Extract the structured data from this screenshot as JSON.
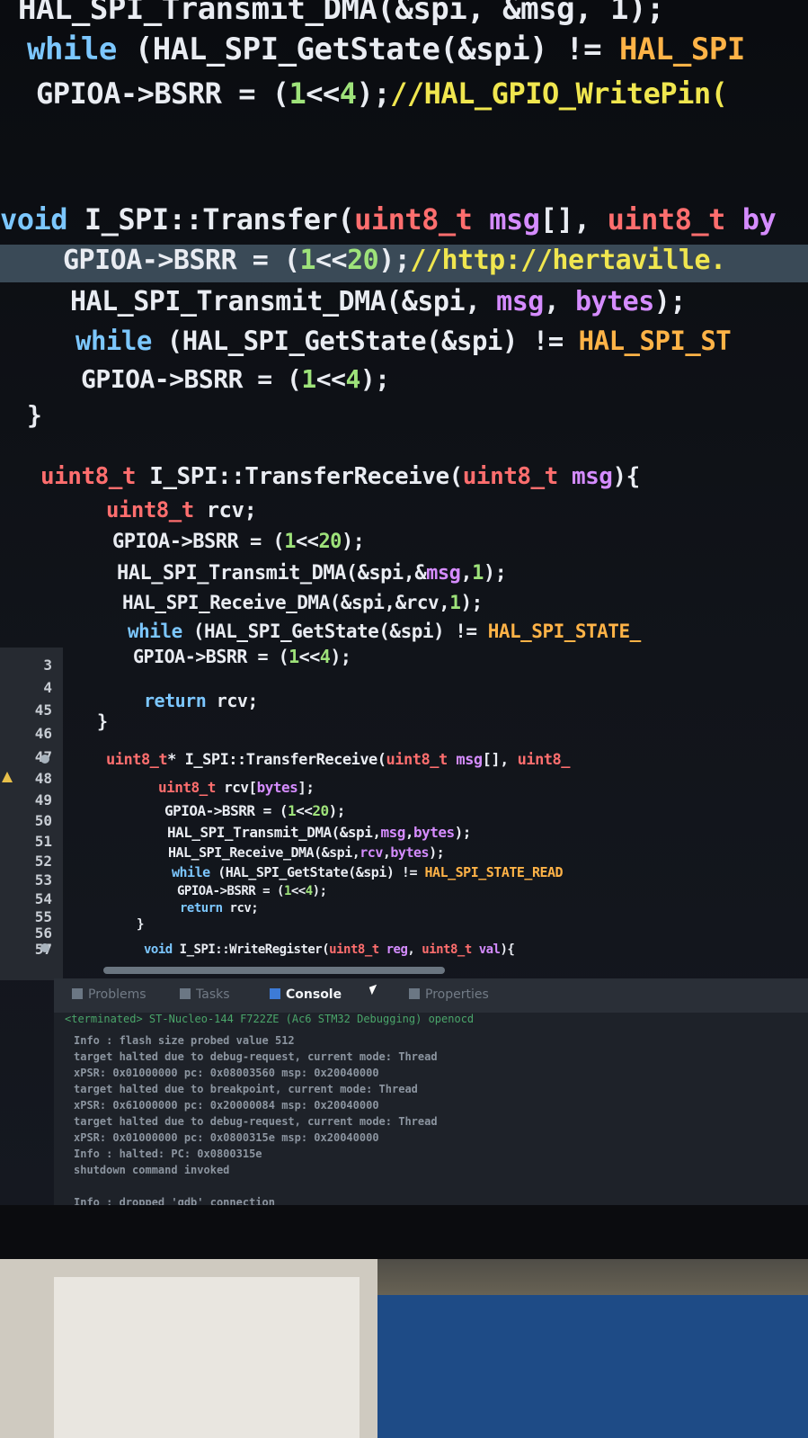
{
  "code_lines": [
    {
      "id": "l1",
      "parts": [
        [
          "tx",
          "HAL_SPI_Transmit_DMA(&spi, &msg, 1);"
        ]
      ]
    },
    {
      "id": "l2",
      "parts": [
        [
          "kw",
          "while "
        ],
        [
          "tx",
          "(HAL_SPI_GetState(&spi) != "
        ],
        [
          "str",
          "HAL_SPI"
        ]
      ]
    },
    {
      "id": "l3",
      "parts": [
        [
          "tx",
          "GPIOA->BSRR = "
        ],
        [
          "tx",
          "("
        ],
        [
          "num",
          "1"
        ],
        [
          "tx",
          "<<"
        ],
        [
          "num",
          "4"
        ],
        [
          "tx",
          ");"
        ],
        [
          "cmt",
          "//HAL_GPIO_WritePin("
        ]
      ]
    },
    {
      "id": "l4",
      "parts": [
        [
          "kw",
          "void "
        ],
        [
          "tx",
          "I_SPI::Transfer("
        ],
        [
          "ty",
          "uint8_t "
        ],
        [
          "par",
          "msg"
        ],
        [
          "tx",
          "[], "
        ],
        [
          "ty",
          "uint8_t "
        ],
        [
          "par",
          "by"
        ]
      ]
    },
    {
      "id": "l5",
      "parts": [
        [
          "tx",
          "GPIOA->BSRR = ("
        ],
        [
          "num",
          "1"
        ],
        [
          "tx",
          "<<"
        ],
        [
          "num",
          "20"
        ],
        [
          "tx",
          ");"
        ],
        [
          "cmt",
          "//http://hertaville."
        ]
      ]
    },
    {
      "id": "l6",
      "parts": [
        [
          "tx",
          "HAL_SPI_Transmit_DMA(&spi, "
        ],
        [
          "par",
          "msg"
        ],
        [
          "tx",
          ", "
        ],
        [
          "par",
          "bytes"
        ],
        [
          "tx",
          ");"
        ]
      ]
    },
    {
      "id": "l7",
      "parts": [
        [
          "kw",
          "while "
        ],
        [
          "tx",
          "(HAL_SPI_GetState(&spi) != "
        ],
        [
          "str",
          "HAL_SPI_ST"
        ]
      ]
    },
    {
      "id": "l8",
      "parts": [
        [
          "tx",
          "GPIOA->BSRR = ("
        ],
        [
          "num",
          "1"
        ],
        [
          "tx",
          "<<"
        ],
        [
          "num",
          "4"
        ],
        [
          "tx",
          ");"
        ]
      ]
    },
    {
      "id": "l9",
      "parts": [
        [
          "tx",
          "}"
        ]
      ]
    },
    {
      "id": "l10",
      "parts": [
        [
          "ty",
          "uint8_t "
        ],
        [
          "tx",
          "I_SPI::TransferReceive("
        ],
        [
          "ty",
          "uint8_t "
        ],
        [
          "par",
          "msg"
        ],
        [
          "tx",
          "){"
        ]
      ]
    },
    {
      "id": "l11",
      "parts": [
        [
          "ty",
          "uint8_t "
        ],
        [
          "tx",
          "rcv;"
        ]
      ]
    },
    {
      "id": "l12",
      "parts": [
        [
          "tx",
          "GPIOA->BSRR = ("
        ],
        [
          "num",
          "1"
        ],
        [
          "tx",
          "<<"
        ],
        [
          "num",
          "20"
        ],
        [
          "tx",
          ");"
        ]
      ]
    },
    {
      "id": "l13",
      "parts": [
        [
          "tx",
          "HAL_SPI_Transmit_DMA(&spi,&"
        ],
        [
          "par",
          "msg"
        ],
        [
          "tx",
          ","
        ],
        [
          "num",
          "1"
        ],
        [
          "tx",
          ");"
        ]
      ]
    },
    {
      "id": "l14",
      "parts": [
        [
          "tx",
          "HAL_SPI_Receive_DMA(&spi,&rcv,"
        ],
        [
          "num",
          "1"
        ],
        [
          "tx",
          ");"
        ]
      ]
    },
    {
      "id": "l15",
      "parts": [
        [
          "kw",
          "while "
        ],
        [
          "tx",
          "(HAL_SPI_GetState(&spi) != "
        ],
        [
          "str",
          "HAL_SPI_STATE_"
        ]
      ]
    },
    {
      "id": "l16",
      "parts": [
        [
          "tx",
          "GPIOA->BSRR = ("
        ],
        [
          "num",
          "1"
        ],
        [
          "tx",
          "<<"
        ],
        [
          "num",
          "4"
        ],
        [
          "tx",
          ");"
        ]
      ]
    },
    {
      "id": "l17",
      "parts": [
        [
          "kw",
          "return "
        ],
        [
          "tx",
          "rcv;"
        ]
      ]
    },
    {
      "id": "l18",
      "parts": [
        [
          "tx",
          "}"
        ]
      ]
    },
    {
      "id": "l19",
      "parts": [
        [
          "ty",
          "uint8_t"
        ],
        [
          "tx",
          "* I_SPI::TransferReceive("
        ],
        [
          "ty",
          "uint8_t "
        ],
        [
          "par",
          "msg"
        ],
        [
          "tx",
          "[], "
        ],
        [
          "ty",
          "uint8_"
        ]
      ]
    },
    {
      "id": "l20",
      "parts": [
        [
          "ty",
          "uint8_t "
        ],
        [
          "tx",
          "rcv["
        ],
        [
          "par",
          "bytes"
        ],
        [
          "tx",
          "];"
        ]
      ]
    },
    {
      "id": "l21",
      "parts": [
        [
          "tx",
          "GPIOA->BSRR = ("
        ],
        [
          "num",
          "1"
        ],
        [
          "tx",
          "<<"
        ],
        [
          "num",
          "20"
        ],
        [
          "tx",
          ");"
        ]
      ]
    },
    {
      "id": "l22",
      "parts": [
        [
          "tx",
          "HAL_SPI_Transmit_DMA(&spi,"
        ],
        [
          "par",
          "msg"
        ],
        [
          "tx",
          ","
        ],
        [
          "par",
          "bytes"
        ],
        [
          "tx",
          ");"
        ]
      ]
    },
    {
      "id": "l23",
      "parts": [
        [
          "tx",
          "HAL_SPI_Receive_DMA(&spi,"
        ],
        [
          "par",
          "rcv"
        ],
        [
          "tx",
          ","
        ],
        [
          "par",
          "bytes"
        ],
        [
          "tx",
          ");"
        ]
      ]
    },
    {
      "id": "l24",
      "parts": [
        [
          "kw",
          "while "
        ],
        [
          "tx",
          "(HAL_SPI_GetState(&spi) != "
        ],
        [
          "str",
          "HAL_SPI_STATE_READ"
        ]
      ]
    },
    {
      "id": "l25",
      "parts": [
        [
          "tx",
          "GPIOA->BSRR = ("
        ],
        [
          "num",
          "1"
        ],
        [
          "tx",
          "<<"
        ],
        [
          "num",
          "4"
        ],
        [
          "tx",
          ");"
        ]
      ]
    },
    {
      "id": "l26",
      "parts": [
        [
          "kw",
          "return "
        ],
        [
          "tx",
          "rcv;"
        ]
      ]
    },
    {
      "id": "l27",
      "parts": [
        [
          "tx",
          "}"
        ]
      ]
    },
    {
      "id": "l28",
      "parts": [
        [
          "kw",
          "void "
        ],
        [
          "tx",
          "I_SPI::WriteRegister("
        ],
        [
          "ty",
          "uint8_t "
        ],
        [
          "par",
          "reg"
        ],
        [
          "tx",
          ", "
        ],
        [
          "ty",
          "uint8_t "
        ],
        [
          "par",
          "val"
        ],
        [
          "tx",
          "){"
        ]
      ]
    }
  ],
  "line_numbers": [
    "3",
    "4",
    "45",
    "46",
    "47",
    "48",
    "49",
    "50",
    "51",
    "52",
    "53",
    "54",
    "55",
    "56",
    "57"
  ],
  "panel": {
    "tabs": [
      {
        "label": "Problems",
        "icon": "problems-icon"
      },
      {
        "label": "Tasks",
        "icon": "tasks-icon"
      },
      {
        "label": "Console",
        "icon": "console-icon"
      },
      {
        "label": "Properties",
        "icon": "properties-icon"
      }
    ],
    "terminated_label": "<terminated> ST-Nucleo-144 F722ZE (Ac6 STM32 Debugging) openocd",
    "console_lines": [
      "Info : flash size probed value 512",
      "target halted due to debug-request, current mode: Thread",
      "xPSR: 0x01000000 pc: 0x08003560 msp: 0x20040000",
      "target halted due to breakpoint, current mode: Thread",
      "xPSR: 0x61000000 pc: 0x20000084 msp: 0x20040000",
      "target halted due to debug-request, current mode: Thread",
      "xPSR: 0x01000000 pc: 0x0800315e msp: 0x20040000",
      "Info : halted: PC: 0x0800315e",
      "shutdown command invoked",
      "",
      "Info : dropped 'gdb' connection"
    ]
  }
}
